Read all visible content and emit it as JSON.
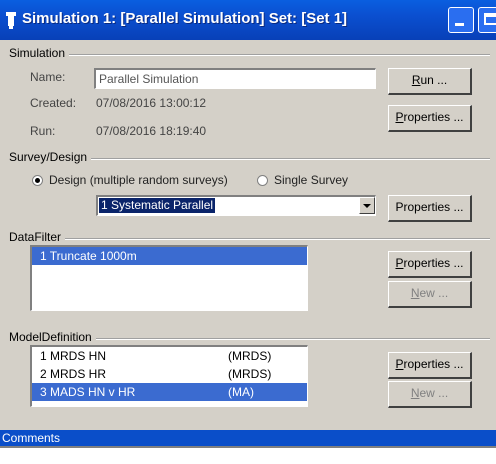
{
  "window": {
    "title": "Simulation 1: [Parallel Simulation] Set: [Set 1]"
  },
  "simulation": {
    "group_label": "Simulation",
    "name_label": "Name:",
    "name_value": "Parallel Simulation",
    "created_label": "Created:",
    "created_value": "07/08/2016 13:00:12",
    "run_label": "Run:",
    "run_value": "07/08/2016 18:19:40",
    "run_button_mnemonic": "R",
    "run_button_rest": "un ...",
    "properties_button_mnemonic": "P",
    "properties_button_rest": "roperties ..."
  },
  "survey": {
    "group_label": "Survey/Design",
    "design_radio_label": "Design (multiple random surveys)",
    "single_radio_label": "Single Survey",
    "selected_radio": "design",
    "design_value": "1 Systematic Parallel",
    "properties_button": "Properties ..."
  },
  "datafilter": {
    "group_label": "DataFilter",
    "items": [
      {
        "text": "1  Truncate 1000m",
        "selected": true
      }
    ],
    "properties_button_mnemonic": "P",
    "properties_button_rest": "roperties ...",
    "new_button_mnemonic": "N",
    "new_button_rest": "ew ..."
  },
  "model": {
    "group_label": "ModelDefinition",
    "items": [
      {
        "name": "1  MRDS HN",
        "engine": "(MRDS)",
        "selected": false
      },
      {
        "name": "2  MRDS HR",
        "engine": "(MRDS)",
        "selected": false
      },
      {
        "name": "3  MADS HN v HR",
        "engine": "(MA)",
        "selected": true
      }
    ],
    "properties_button_mnemonic": "P",
    "properties_button_rest": "roperties ...",
    "new_button_mnemonic": "N",
    "new_button_rest": "ew ..."
  },
  "comments": {
    "label": "Comments"
  },
  "colors": {
    "titlebar": "#0b4fd0",
    "selection": "#3b6bd0",
    "dialog": "#d4d0c8"
  }
}
